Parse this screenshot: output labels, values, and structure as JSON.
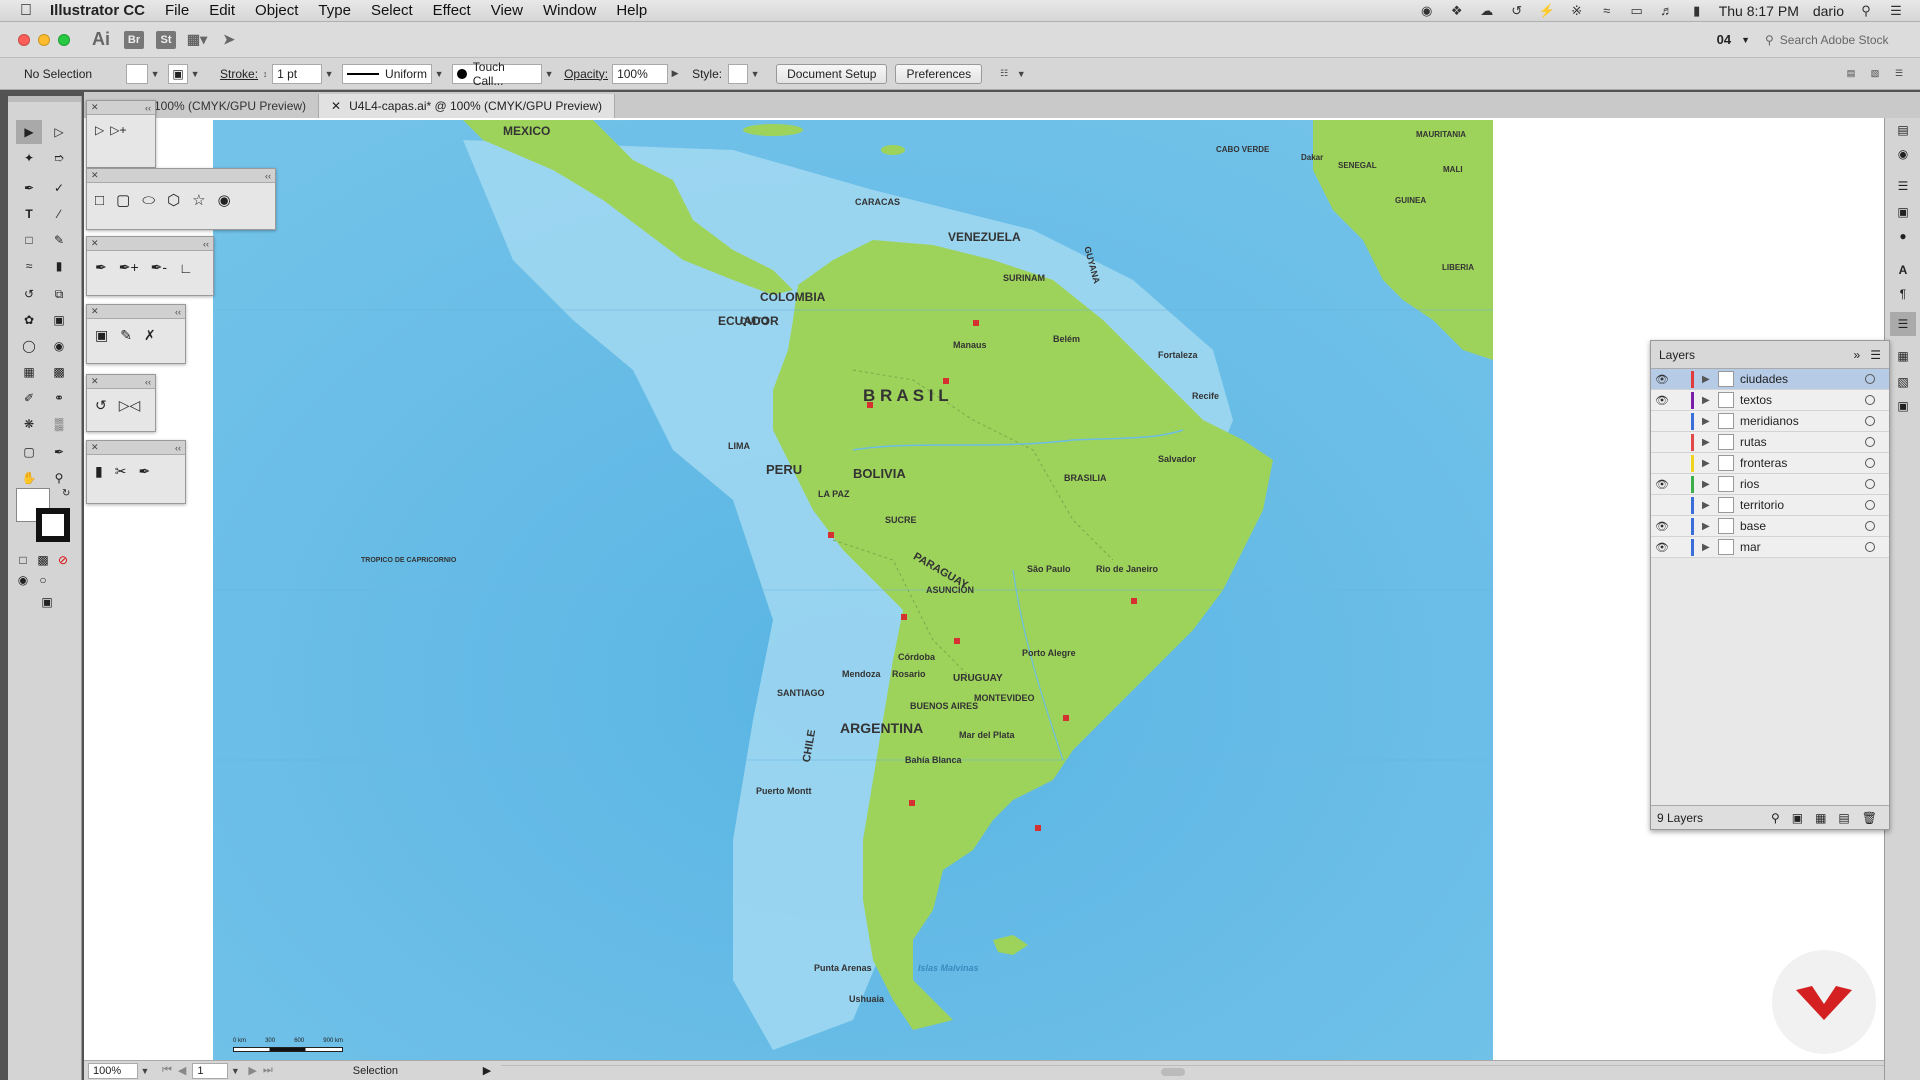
{
  "menubar": {
    "app_name": "Illustrator CC",
    "menus": [
      "File",
      "Edit",
      "Object",
      "Type",
      "Select",
      "Effect",
      "View",
      "Window",
      "Help"
    ],
    "clock": "Thu 8:17 PM",
    "user": "dario"
  },
  "titlebar": {
    "ai_label": "Ai",
    "br_label": "Br",
    "st_label": "St",
    "workspace": "04",
    "search_placeholder": "Search Adobe Stock"
  },
  "control": {
    "selection_state": "No Selection",
    "stroke_label": "Stroke:",
    "stroke_value": "1 pt",
    "profile": "Uniform",
    "brush": "Touch Call...",
    "opacity_label": "Opacity:",
    "opacity_value": "100%",
    "style_label": "Style:",
    "document_setup": "Document Setup",
    "preferences": "Preferences"
  },
  "tabs": [
    {
      "label": "100% (CMYK/GPU Preview)"
    },
    {
      "label": "U4L4-capas.ai* @ 100% (CMYK/GPU Preview)"
    }
  ],
  "layers_panel": {
    "title": "Layers",
    "count": "9 Layers",
    "layers": [
      {
        "name": "ciudades",
        "visible": true,
        "color": "#e23b3b",
        "selected": true
      },
      {
        "name": "textos",
        "visible": true,
        "color": "#7a1fa8",
        "selected": false
      },
      {
        "name": "meridianos",
        "visible": false,
        "color": "#3a6ed8",
        "selected": false
      },
      {
        "name": "rutas",
        "visible": false,
        "color": "#e24a4a",
        "selected": false
      },
      {
        "name": "fronteras",
        "visible": false,
        "color": "#f0d420",
        "selected": false
      },
      {
        "name": "rios",
        "visible": true,
        "color": "#3bb04a",
        "selected": false
      },
      {
        "name": "territorio",
        "visible": false,
        "color": "#3a6ed8",
        "selected": false
      },
      {
        "name": "base",
        "visible": true,
        "color": "#3a6ed8",
        "selected": false
      },
      {
        "name": "mar",
        "visible": true,
        "color": "#3a6ed8",
        "selected": false
      }
    ]
  },
  "map": {
    "labels": [
      "MEXICO",
      "VENEZUELA",
      "COLOMBIA",
      "ECUADOR",
      "PERU",
      "BOLIVIA",
      "B R A S I L",
      "PARAGUAY",
      "ARGENTINA",
      "URUGUAY",
      "CHILE",
      "GUYANA",
      "SURINAM",
      "CARACAS",
      "QUITO",
      "LIMA",
      "LA PAZ",
      "SUCRE",
      "ASUNCIÓN",
      "BUENOS AIRES",
      "MONTEVIDEO",
      "SANTIAGO",
      "BRASILIA",
      "Rio de Janeiro",
      "São Paulo",
      "Recife",
      "Salvador",
      "Fortaleza",
      "Manaus",
      "Belém",
      "Porto Alegre",
      "Córdoba",
      "Mendoza",
      "Rosario",
      "Bahía Blanca",
      "Mar del Plata",
      "Puerto Montt",
      "Punta Arenas",
      "Ushuaia",
      "Islas Malvinas",
      "TROPICO DE CAPRICORNIO",
      "CABO VERDE",
      "SENEGAL",
      "MALI",
      "GUINEA",
      "LIBERIA",
      "MAURITANIA",
      "Dakar"
    ],
    "scale": [
      "0 km",
      "300",
      "600",
      "900 km"
    ]
  },
  "status": {
    "zoom": "100%",
    "page": "1",
    "tool": "Selection"
  }
}
